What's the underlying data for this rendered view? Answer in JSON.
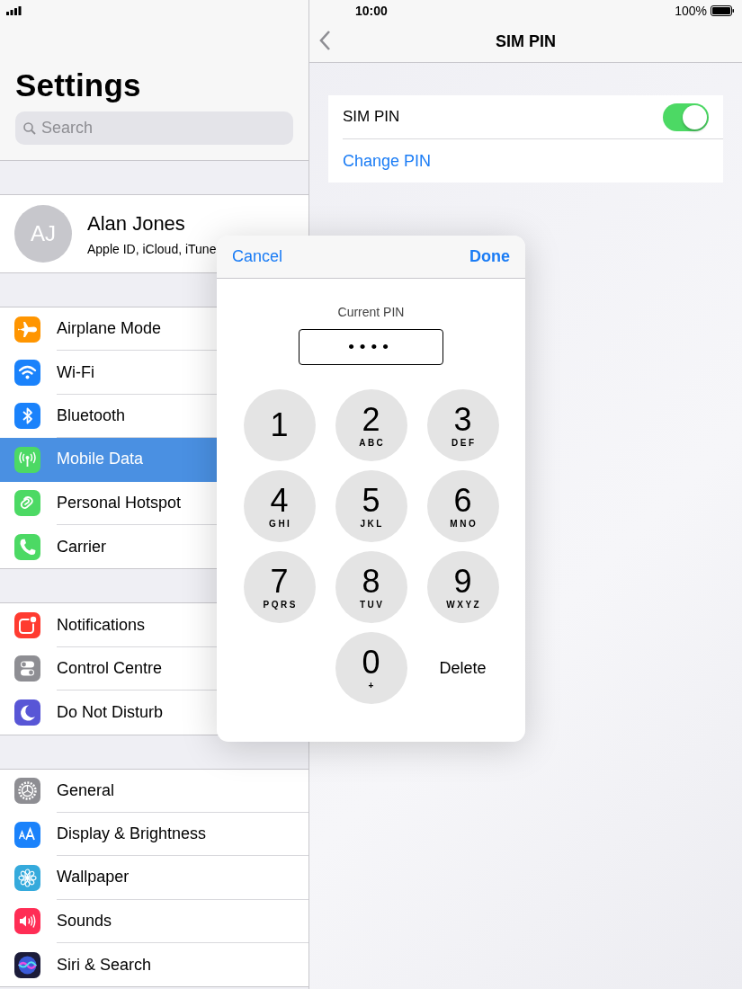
{
  "status_bar": {
    "time": "10:00",
    "battery": "100%"
  },
  "sidebar": {
    "title": "Settings",
    "search": {
      "placeholder": "Search"
    },
    "profile": {
      "initials": "AJ",
      "name": "Alan Jones",
      "subtitle": "Apple ID, iCloud, iTune"
    },
    "groups": [
      [
        {
          "label": "Airplane Mode",
          "color": "#ff9500",
          "selected": false
        },
        {
          "label": "Wi-Fi",
          "color": "#1a82fb",
          "selected": false
        },
        {
          "label": "Bluetooth",
          "color": "#1a82fb",
          "selected": false
        },
        {
          "label": "Mobile Data",
          "color": "#4cd964",
          "selected": true
        },
        {
          "label": "Personal Hotspot",
          "color": "#4cd964",
          "selected": false
        },
        {
          "label": "Carrier",
          "color": "#4cd964",
          "selected": false
        }
      ],
      [
        {
          "label": "Notifications",
          "color": "#ff3b30",
          "selected": false
        },
        {
          "label": "Control Centre",
          "color": "#8e8e93",
          "selected": false
        },
        {
          "label": "Do Not Disturb",
          "color": "#5856d6",
          "selected": false
        }
      ],
      [
        {
          "label": "General",
          "color": "#8e8e93",
          "selected": false
        },
        {
          "label": "Display & Brightness",
          "color": "#1a82fb",
          "selected": false
        },
        {
          "label": "Wallpaper",
          "color": "#35aadc",
          "selected": false
        },
        {
          "label": "Sounds",
          "color": "#ff2d55",
          "selected": false
        },
        {
          "label": "Siri & Search",
          "color": "#1c1c3a",
          "selected": false
        }
      ]
    ]
  },
  "detail": {
    "title": "SIM PIN",
    "rows": [
      {
        "kind": "toggle",
        "label": "SIM PIN",
        "on": true
      },
      {
        "kind": "link",
        "label": "Change PIN"
      }
    ]
  },
  "dialog": {
    "cancel": "Cancel",
    "done": "Done",
    "field_label": "Current PIN",
    "field_value": "••••",
    "keys": [
      {
        "digit": "1"
      },
      {
        "digit": "2",
        "letters": "ABC"
      },
      {
        "digit": "3",
        "letters": "DEF"
      },
      {
        "digit": "4",
        "letters": "GHI"
      },
      {
        "digit": "5",
        "letters": "JKL"
      },
      {
        "digit": "6",
        "letters": "MNO"
      },
      {
        "digit": "7",
        "letters": "PQRS"
      },
      {
        "digit": "8",
        "letters": "TUV"
      },
      {
        "digit": "9",
        "letters": "WXYZ"
      },
      {
        "digit": "0",
        "letters": "+"
      }
    ],
    "delete": "Delete"
  }
}
